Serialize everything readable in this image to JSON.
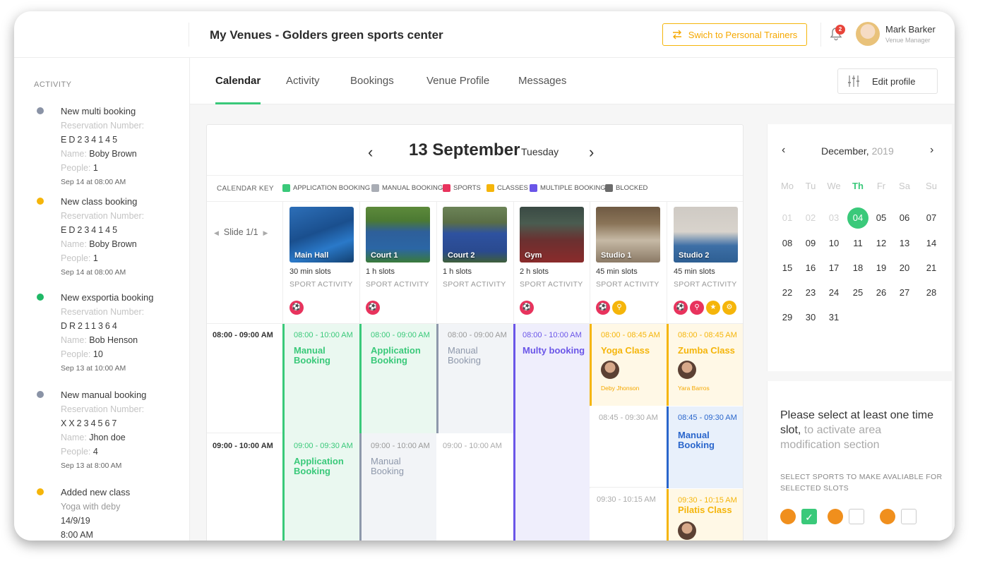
{
  "header": {
    "title": "My Venues - Golders green sports center",
    "switch_label": "Swich to Personal Trainers",
    "notification_count": "2",
    "user_name": "Mark Barker",
    "user_role": "Venue Manager"
  },
  "sidebar": {
    "title": "ACTIVITY",
    "activities": [
      {
        "title": "New multi booking",
        "color": "#8a93a6",
        "l1k": "Reservation Number:",
        "l2": "ED234145",
        "l3k": "Name:",
        "l3v": " Boby Brown",
        "l4k": "People:",
        "l4v": " 1",
        "time": "Sep 14 at 08:00 AM"
      },
      {
        "title": "New class booking",
        "color": "#f5b50a",
        "l1k": "Reservation Number:",
        "l2": "ED234145",
        "l3k": "Name:",
        "l3v": " Boby Brown",
        "l4k": "People:",
        "l4v": " 1",
        "time": "Sep 14 at 08:00 AM"
      },
      {
        "title": "New exsportia booking",
        "color": "#1fb866",
        "l1k": "Reservation Number:",
        "l2": "DR211364",
        "l3k": "Name:",
        "l3v": " Bob Henson",
        "l4k": "People:",
        "l4v": " 10",
        "time": "Sep 13 at 10:00 AM"
      },
      {
        "title": "New manual booking",
        "color": "#8a93a6",
        "l1k": "Reservation Number:",
        "l2": "XX234567",
        "l3k": "Name:",
        "l3v": " Jhon doe",
        "l4k": "People:",
        "l4v": " 4",
        "time": "Sep 13 at 8:00 AM"
      },
      {
        "title": "Added new class",
        "color": "#f5b50a",
        "l1k": "Yoga with deby",
        "l2": "14/9/19",
        "l3k": "",
        "l3v": "8:00 AM",
        "l4k": "",
        "l4v": "",
        "time": ""
      }
    ]
  },
  "tabs": [
    "Calendar",
    "Activity",
    "Bookings",
    "Venue Profile",
    "Messages"
  ],
  "edit_profile_label": "Edit profile",
  "calendar": {
    "date": "13 September",
    "weekday": "Tuesday",
    "key_title": "CALENDAR KEY",
    "key": [
      {
        "label": "APPLICATION BOOKING",
        "color": "#3ac97a"
      },
      {
        "label": "MANUAL BOOKING",
        "color": "#a9adb5"
      },
      {
        "label": "SPORTS",
        "color": "#e8335d"
      },
      {
        "label": "CLASSES",
        "color": "#f5b50a"
      },
      {
        "label": "MULTIPLE BOOKING",
        "color": "#6a55e8"
      },
      {
        "label": "BLOCKED",
        "color": "#6b6b6b"
      }
    ],
    "slide_label": "Slide 1/1",
    "venues": [
      {
        "name": "Main Hall",
        "slots": "30 min slots",
        "type": "SPORT ACTIVITY"
      },
      {
        "name": "Court 1",
        "slots": "1 h slots",
        "type": "SPORT ACTIVITY"
      },
      {
        "name": "Court 2",
        "slots": "1 h slots",
        "type": "SPORT ACTIVITY"
      },
      {
        "name": "Gym",
        "slots": "2 h slots",
        "type": "SPORT ACTIVITY"
      },
      {
        "name": "Studio 1",
        "slots": "45 min slots",
        "type": "SPORT ACTIVITY"
      },
      {
        "name": "Studio 2",
        "slots": "45 min slots",
        "type": "SPORT ACTIVITY"
      }
    ],
    "time_rows": [
      "08:00 - 09:00 AM",
      "09:00 - 10:00 AM"
    ],
    "bookings": {
      "b1": {
        "time": "08:00 - 10:00 AM",
        "name": "Manual Booking"
      },
      "b2": {
        "time": "08:00 - 09:00 AM",
        "name": "Application Booking"
      },
      "b3": {
        "time": "08:00 - 09:00 AM",
        "name": "Manual Booking"
      },
      "b4": {
        "time": "08:00 - 10:00 AM",
        "name": "Multy booking"
      },
      "b5": {
        "time": "08:00 - 08:45 AM",
        "name": "Yoga Class",
        "coach": "Deby Jhonson"
      },
      "b6": {
        "time": "08:00 - 08:45 AM",
        "name": "Zumba Class",
        "coach": "Yara Barros"
      },
      "b7": {
        "time": "09:00 - 09:30 AM",
        "name": "Application Booking"
      },
      "b8": {
        "time": "09:00 - 10:00 AM",
        "name": "Manual Booking"
      },
      "b9": {
        "time": "09:00 - 10:00 AM"
      },
      "b10": {
        "time": "08:45 - 09:30 AM"
      },
      "b11": {
        "time": "08:45 - 09:30 AM",
        "name": "Manual Booking"
      },
      "b12": {
        "time": "09:30 - 10:15 AM"
      },
      "b13": {
        "time": "09:30 - 10:15 AM",
        "name": "Pilatis Class"
      }
    }
  },
  "mini_calendar": {
    "month": "December,",
    "year": "2019",
    "weekdays": [
      "Mo",
      "Tu",
      "We",
      "Th",
      "Fr",
      "Sa",
      "Su"
    ],
    "selected_day": "04"
  },
  "modify_panel": {
    "message": "Please select at least one time slot,",
    "message_light": " to activate area modification section",
    "subtitle": "SELECT SPORTS TO MAKE AVALIABLE FOR SELECTED SLOTS"
  }
}
